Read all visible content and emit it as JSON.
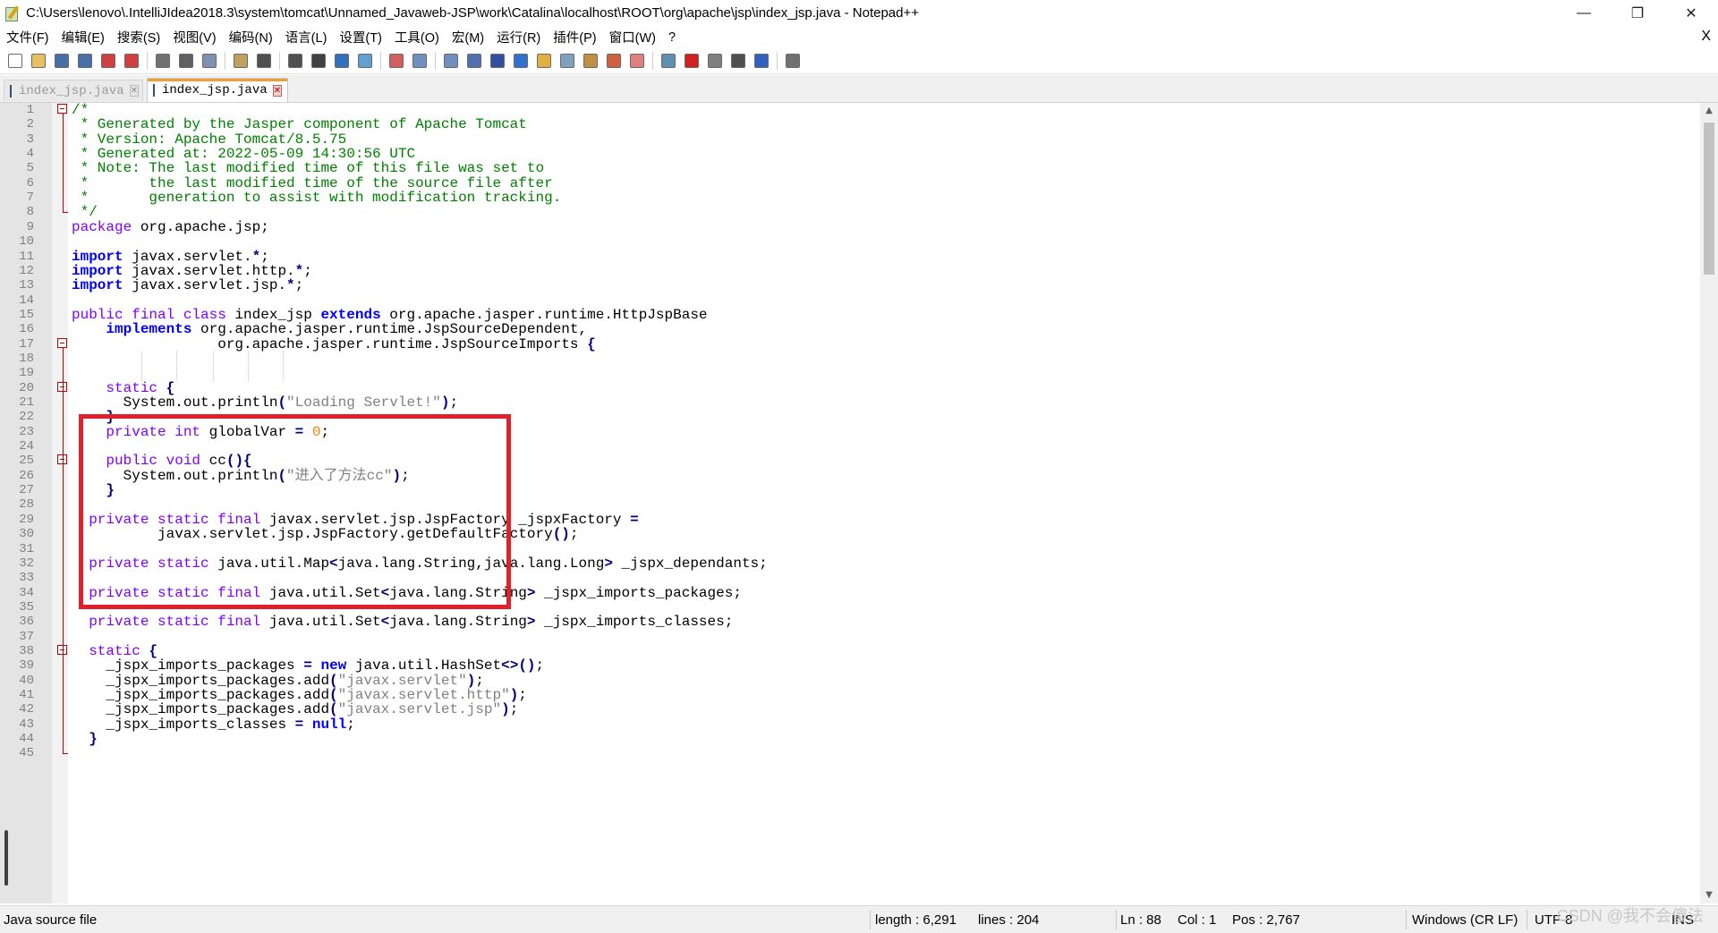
{
  "window": {
    "title": "C:\\Users\\lenovo\\.IntelliJIdea2018.3\\system\\tomcat\\Unnamed_Javaweb-JSP\\work\\Catalina\\localhost\\ROOT\\org\\apache\\jsp\\index_jsp.java - Notepad++",
    "minimize_glyph": "—",
    "restore_glyph": "❐",
    "close_glyph": "✕"
  },
  "menu": {
    "items": [
      "文件(F)",
      "编辑(E)",
      "搜索(S)",
      "视图(V)",
      "编码(N)",
      "语言(L)",
      "设置(T)",
      "工具(O)",
      "宏(M)",
      "运行(R)",
      "插件(P)",
      "窗口(W)",
      "?"
    ],
    "close_glyph": "X"
  },
  "toolbar": {
    "buttons": [
      {
        "name": "new-file-icon",
        "color": "#ffffff"
      },
      {
        "name": "open-file-icon",
        "color": "#e8c060"
      },
      {
        "name": "save-icon",
        "color": "#4a6fa5"
      },
      {
        "name": "save-all-icon",
        "color": "#4a6fa5"
      },
      {
        "name": "close-icon",
        "color": "#d04040"
      },
      {
        "name": "close-all-icon",
        "color": "#d04040"
      },
      {
        "name": "print-icon",
        "color": "#707070"
      },
      {
        "name": "cut-icon",
        "color": "#606060"
      },
      {
        "name": "copy-icon",
        "color": "#8090b0"
      },
      {
        "name": "paste-icon",
        "color": "#c0a060"
      },
      {
        "name": "undo-icon",
        "color": "#505050"
      },
      {
        "name": "redo-icon",
        "color": "#505050"
      },
      {
        "name": "find-icon",
        "color": "#404040"
      },
      {
        "name": "replace-icon",
        "color": "#3070c0"
      },
      {
        "name": "zoom-in-icon",
        "color": "#60a0d0"
      },
      {
        "name": "zoom-out-icon",
        "color": "#d06060"
      },
      {
        "name": "sync-vertical-icon",
        "color": "#7090c0"
      },
      {
        "name": "sync-horizontal-icon",
        "color": "#7090c0"
      },
      {
        "name": "word-wrap-icon",
        "color": "#5070b0"
      },
      {
        "name": "show-all-chars-icon",
        "color": "#3050a0"
      },
      {
        "name": "indent-guide-icon",
        "color": "#3070d0"
      },
      {
        "name": "udl-icon",
        "color": "#e0b040"
      },
      {
        "name": "doc-map-icon",
        "color": "#80a0c0"
      },
      {
        "name": "function-list-icon",
        "color": "#c09040"
      },
      {
        "name": "folder-workspace-icon",
        "color": "#d06040"
      },
      {
        "name": "monitoring-icon",
        "color": "#e08080"
      },
      {
        "name": "eye-icon",
        "color": "#6090b0"
      },
      {
        "name": "record-macro-icon",
        "color": "#d02020"
      },
      {
        "name": "stop-macro-icon",
        "color": "#808080"
      },
      {
        "name": "play-macro-icon",
        "color": "#505050"
      },
      {
        "name": "run-macro-multiple-icon",
        "color": "#3060c0"
      },
      {
        "name": "save-macro-icon",
        "color": "#707070"
      }
    ]
  },
  "tabs": [
    {
      "label": "index_jsp.java",
      "close": "✕",
      "active": false
    },
    {
      "label": "index_jsp.java",
      "close": "✕",
      "active": true
    }
  ],
  "editor": {
    "lines": [
      {
        "n": "1",
        "html": "<span class='tok-comment'>/*</span>"
      },
      {
        "n": "2",
        "html": "<span class='tok-comment'> * Generated by the Jasper component of Apache Tomcat</span>"
      },
      {
        "n": "3",
        "html": "<span class='tok-comment'> * Version: Apache Tomcat/8.5.75</span>"
      },
      {
        "n": "4",
        "html": "<span class='tok-comment'> * Generated at: 2022-05-09 14:30:56 UTC</span>"
      },
      {
        "n": "5",
        "html": "<span class='tok-comment'> * Note: The last modified time of this file was set to</span>"
      },
      {
        "n": "6",
        "html": "<span class='tok-comment'> *       the last modified time of the source file after</span>"
      },
      {
        "n": "7",
        "html": "<span class='tok-comment'> *       generation to assist with modification tracking.</span>"
      },
      {
        "n": "8",
        "html": "<span class='tok-comment'> */</span>"
      },
      {
        "n": "9",
        "html": "<span class='tok-kw'>package</span> org.apache.jsp;"
      },
      {
        "n": "10",
        "html": ""
      },
      {
        "n": "11",
        "html": "<span class='tok-bold'>import</span> javax.servlet.<span class='tok-op'>*</span>;"
      },
      {
        "n": "12",
        "html": "<span class='tok-bold'>import</span> javax.servlet.http.<span class='tok-op'>*</span>;"
      },
      {
        "n": "13",
        "html": "<span class='tok-bold'>import</span> javax.servlet.jsp.<span class='tok-op'>*</span>;"
      },
      {
        "n": "14",
        "html": ""
      },
      {
        "n": "15",
        "html": "<span class='tok-kw'>public final class</span> index_jsp <span class='tok-bold'>extends</span> org.apache.jasper.runtime.HttpJspBase"
      },
      {
        "n": "16",
        "html": "    <span class='tok-bold'>implements</span> org.apache.jasper.runtime.JspSourceDependent,"
      },
      {
        "n": "17",
        "html": "                 org.apache.jasper.runtime.JspSourceImports <span class='tok-op'>{</span>"
      },
      {
        "n": "18",
        "html": ""
      },
      {
        "n": "19",
        "html": ""
      },
      {
        "n": "20",
        "html": "    <span class='tok-kw'>static</span> <span class='tok-op'>{</span>"
      },
      {
        "n": "21",
        "html": "      System.out.println<span class='tok-op'>(</span><span class='tok-str'>\"Loading Servlet!\"</span><span class='tok-op'>)</span>;"
      },
      {
        "n": "22",
        "html": "    <span class='tok-op'>}</span>"
      },
      {
        "n": "23",
        "html": "    <span class='tok-kw'>private int</span> globalVar <span class='tok-op'>=</span> <span class='tok-num'>0</span>;"
      },
      {
        "n": "24",
        "html": ""
      },
      {
        "n": "25",
        "html": "    <span class='tok-kw'>public void</span> cc<span class='tok-op'>(){</span>"
      },
      {
        "n": "26",
        "html": "      System.out.println<span class='tok-op'>(</span><span class='tok-str'>\"进入了方法cc\"</span><span class='tok-op'>)</span>;"
      },
      {
        "n": "27",
        "html": "    <span class='tok-op'>}</span>"
      },
      {
        "n": "28",
        "html": ""
      },
      {
        "n": "29",
        "html": "  <span class='tok-kw'>private static final</span> javax.servlet.jsp.JspFactory _jspxFactory <span class='tok-op'>=</span>"
      },
      {
        "n": "30",
        "html": "          javax.servlet.jsp.JspFactory.getDefaultFactory<span class='tok-op'>()</span>;"
      },
      {
        "n": "31",
        "html": ""
      },
      {
        "n": "32",
        "html": "  <span class='tok-kw'>private static</span> java.util.Map<span class='tok-op'>&lt;</span>java.lang.String,java.lang.Long<span class='tok-op'>&gt;</span> _jspx_dependants;"
      },
      {
        "n": "33",
        "html": ""
      },
      {
        "n": "34",
        "html": "  <span class='tok-kw'>private static final</span> java.util.Set<span class='tok-op'>&lt;</span>java.lang.String<span class='tok-op'>&gt;</span> _jspx_imports_packages;"
      },
      {
        "n": "35",
        "html": ""
      },
      {
        "n": "36",
        "html": "  <span class='tok-kw'>private static final</span> java.util.Set<span class='tok-op'>&lt;</span>java.lang.String<span class='tok-op'>&gt;</span> _jspx_imports_classes;"
      },
      {
        "n": "37",
        "html": ""
      },
      {
        "n": "38",
        "html": "  <span class='tok-kw'>static</span> <span class='tok-op'>{</span>"
      },
      {
        "n": "39",
        "html": "    _jspx_imports_packages <span class='tok-op'>=</span> <span class='tok-bold'>new</span> java.util.HashSet<span class='tok-op'>&lt;&gt;()</span>;"
      },
      {
        "n": "40",
        "html": "    _jspx_imports_packages.add<span class='tok-op'>(</span><span class='tok-str'>\"javax.servlet\"</span><span class='tok-op'>)</span>;"
      },
      {
        "n": "41",
        "html": "    _jspx_imports_packages.add<span class='tok-op'>(</span><span class='tok-str'>\"javax.servlet.http\"</span><span class='tok-op'>)</span>;"
      },
      {
        "n": "42",
        "html": "    _jspx_imports_packages.add<span class='tok-op'>(</span><span class='tok-str'>\"javax.servlet.jsp\"</span><span class='tok-op'>)</span>;"
      },
      {
        "n": "43",
        "html": "    _jspx_imports_classes <span class='tok-op'>=</span> <span class='tok-bold'>null</span>;"
      },
      {
        "n": "44",
        "html": "  <span class='tok-op'>}</span>"
      },
      {
        "n": "45",
        "html": ""
      }
    ]
  },
  "statusbar": {
    "file_type": "Java source file",
    "length": "length : 6,291",
    "lines": "lines : 204",
    "ln": "Ln : 88",
    "col": "Col : 1",
    "pos": "Pos : 2,767",
    "eol": "Windows (CR LF)",
    "encoding": "UTF-8",
    "mode": "INS"
  },
  "watermark": "CSDN @我不会傻法"
}
